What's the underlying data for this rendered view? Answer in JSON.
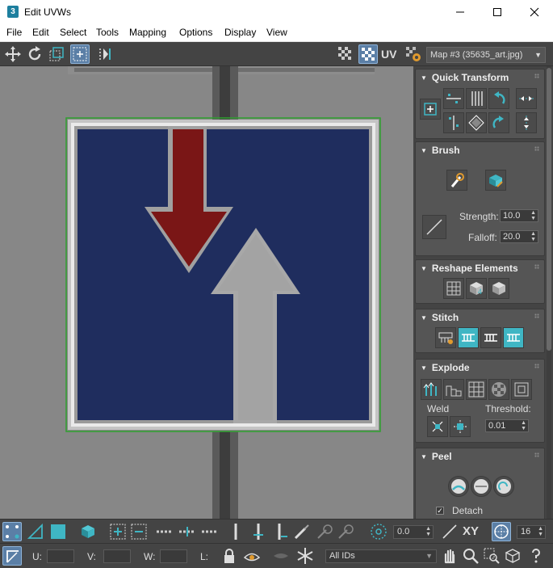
{
  "window": {
    "app_icon": "3",
    "title": "Edit UVWs",
    "controls": [
      "minimize-icon",
      "maximize-icon",
      "close-icon"
    ]
  },
  "menu": [
    "File",
    "Edit",
    "Select",
    "Tools",
    "Mapping",
    "Options",
    "Display",
    "View"
  ],
  "toolbar": {
    "uv_label": "UV",
    "map_dropdown": "Map #3 (35635_art.jpg)"
  },
  "panel": {
    "quick_transform": {
      "title": "Quick Transform"
    },
    "brush": {
      "title": "Brush",
      "strength_label": "Strength:",
      "strength_value": "10.0",
      "falloff_label": "Falloff:",
      "falloff_value": "20.0"
    },
    "reshape": {
      "title": "Reshape Elements"
    },
    "stitch": {
      "title": "Stitch"
    },
    "explode": {
      "title": "Explode",
      "weld_label": "Weld",
      "threshold_label": "Threshold:",
      "threshold_value": "0.01"
    },
    "peel": {
      "title": "Peel",
      "detach_label": "Detach",
      "detach_checked": true
    }
  },
  "bottom": {
    "rotate_value": "0.0",
    "xy_label": "XY",
    "grid_value": "16",
    "u_label": "U:",
    "v_label": "V:",
    "w_label": "W:",
    "l_label": "L:",
    "id_filter": "All IDs"
  },
  "colors": {
    "sign_blue": "#1f2d5e",
    "arrow_red": "#7a1616",
    "arrow_white": "#a8a8a8",
    "accent_teal": "#3fb6c4",
    "active_blue": "#5b7fa6"
  }
}
